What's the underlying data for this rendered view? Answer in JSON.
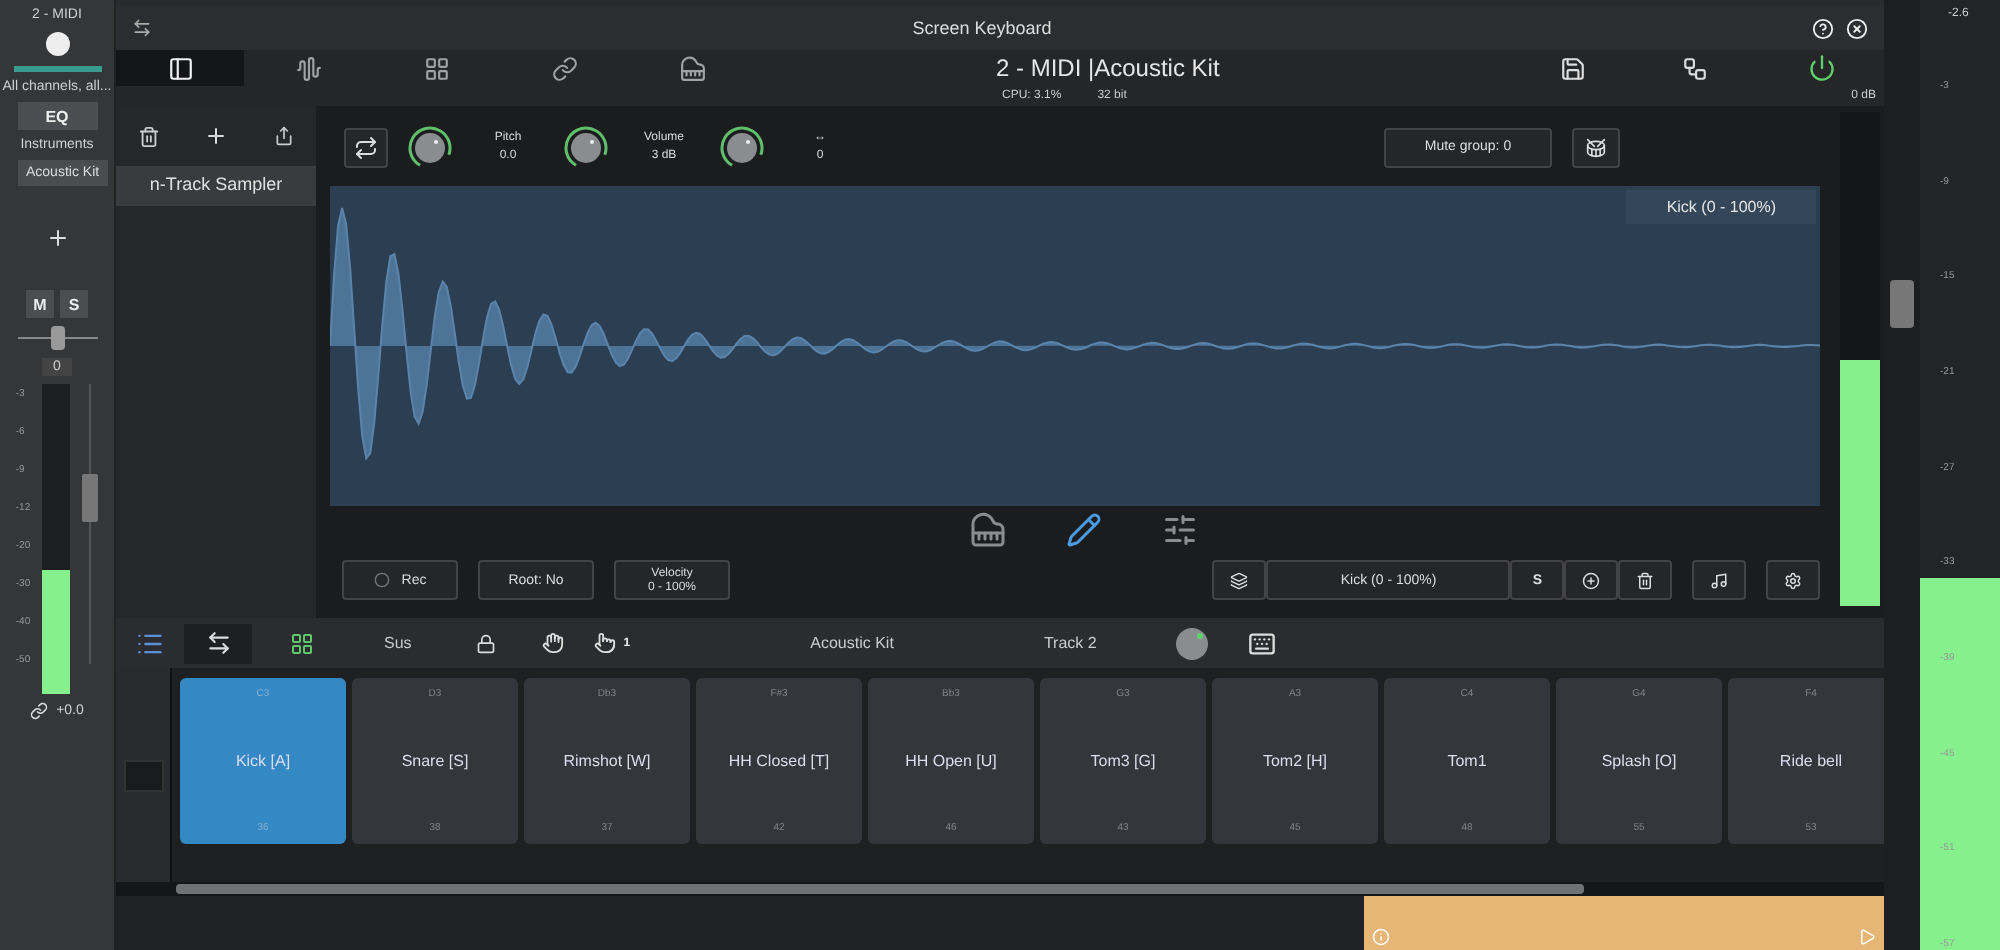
{
  "mixer_strip": {
    "track_name": "2 - MIDI",
    "channels": "All channels, all...",
    "eq_button": "EQ",
    "instruments_label": "Instruments",
    "instrument": "Acoustic Kit",
    "mute_button": "M",
    "solo_button": "S",
    "pan": {
      "level": 0.5
    },
    "pan_value": "0",
    "meter_scale": [
      "-3",
      "-6",
      "-9",
      "-12",
      "-20",
      "-30",
      "-40",
      "-50"
    ],
    "level": 0.4,
    "gain": "+0.0"
  },
  "window": {
    "title": "Screen Keyboard"
  },
  "view_tabs": [
    {
      "selected": true
    },
    {
      "selected": false
    },
    {
      "selected": false
    },
    {
      "selected": false
    },
    {
      "selected": false
    }
  ],
  "track_title": "2 - MIDI |Acoustic Kit",
  "status": {
    "cpu": "CPU: 3.1%",
    "bit_depth": "32 bit",
    "output": "0 dB"
  },
  "sidebar": {
    "items": [
      {
        "label": "n-Track Sampler",
        "selected": true
      }
    ]
  },
  "controls": [
    {
      "label": "Pitch",
      "value": "0.0"
    },
    {
      "label": "Volume",
      "value": "3 dB"
    },
    {
      "label": "↔",
      "value": "0"
    }
  ],
  "mute_group": "Mute group: 0",
  "sample": {
    "label": "Kick (0 - 100%)"
  },
  "output_meter": {
    "level": 0.5
  },
  "edit_tools": [
    {
      "selected": false
    },
    {
      "selected": true
    },
    {
      "selected": false
    }
  ],
  "bottom_controls": {
    "rec": "Rec",
    "root": "Root: No",
    "velocity_label": "Velocity",
    "velocity_range": "0 - 100%",
    "zone": "Kick (0 - 100%)",
    "solo": "S"
  },
  "pad_toolbar": {
    "sus": "Sus",
    "finger_badge": "1",
    "kit": "Acoustic Kit",
    "track": "Track 2"
  },
  "pads": [
    {
      "note": "C3",
      "name": "Kick [A]",
      "number": "36",
      "selected": true
    },
    {
      "note": "D3",
      "name": "Snare [S]",
      "number": "38",
      "selected": false
    },
    {
      "note": "Db3",
      "name": "Rimshot [W]",
      "number": "37",
      "selected": false
    },
    {
      "note": "F#3",
      "name": "HH Closed [T]",
      "number": "42",
      "selected": false
    },
    {
      "note": "Bb3",
      "name": "HH Open [U]",
      "number": "46",
      "selected": false
    },
    {
      "note": "G3",
      "name": "Tom3 [G]",
      "number": "43",
      "selected": false
    },
    {
      "note": "A3",
      "name": "Tom2 [H]",
      "number": "45",
      "selected": false
    },
    {
      "note": "C4",
      "name": "Tom1",
      "number": "48",
      "selected": false
    },
    {
      "note": "G4",
      "name": "Splash [O]",
      "number": "55",
      "selected": false
    },
    {
      "note": "F4",
      "name": "Ride bell",
      "number": "53",
      "selected": false
    }
  ],
  "master": {
    "peak": "-2.6",
    "scale": [
      "-3",
      "-9",
      "-15",
      "-21",
      "-27",
      "-33",
      "-39",
      "-45",
      "-51",
      "-57"
    ],
    "level": 0.4
  }
}
